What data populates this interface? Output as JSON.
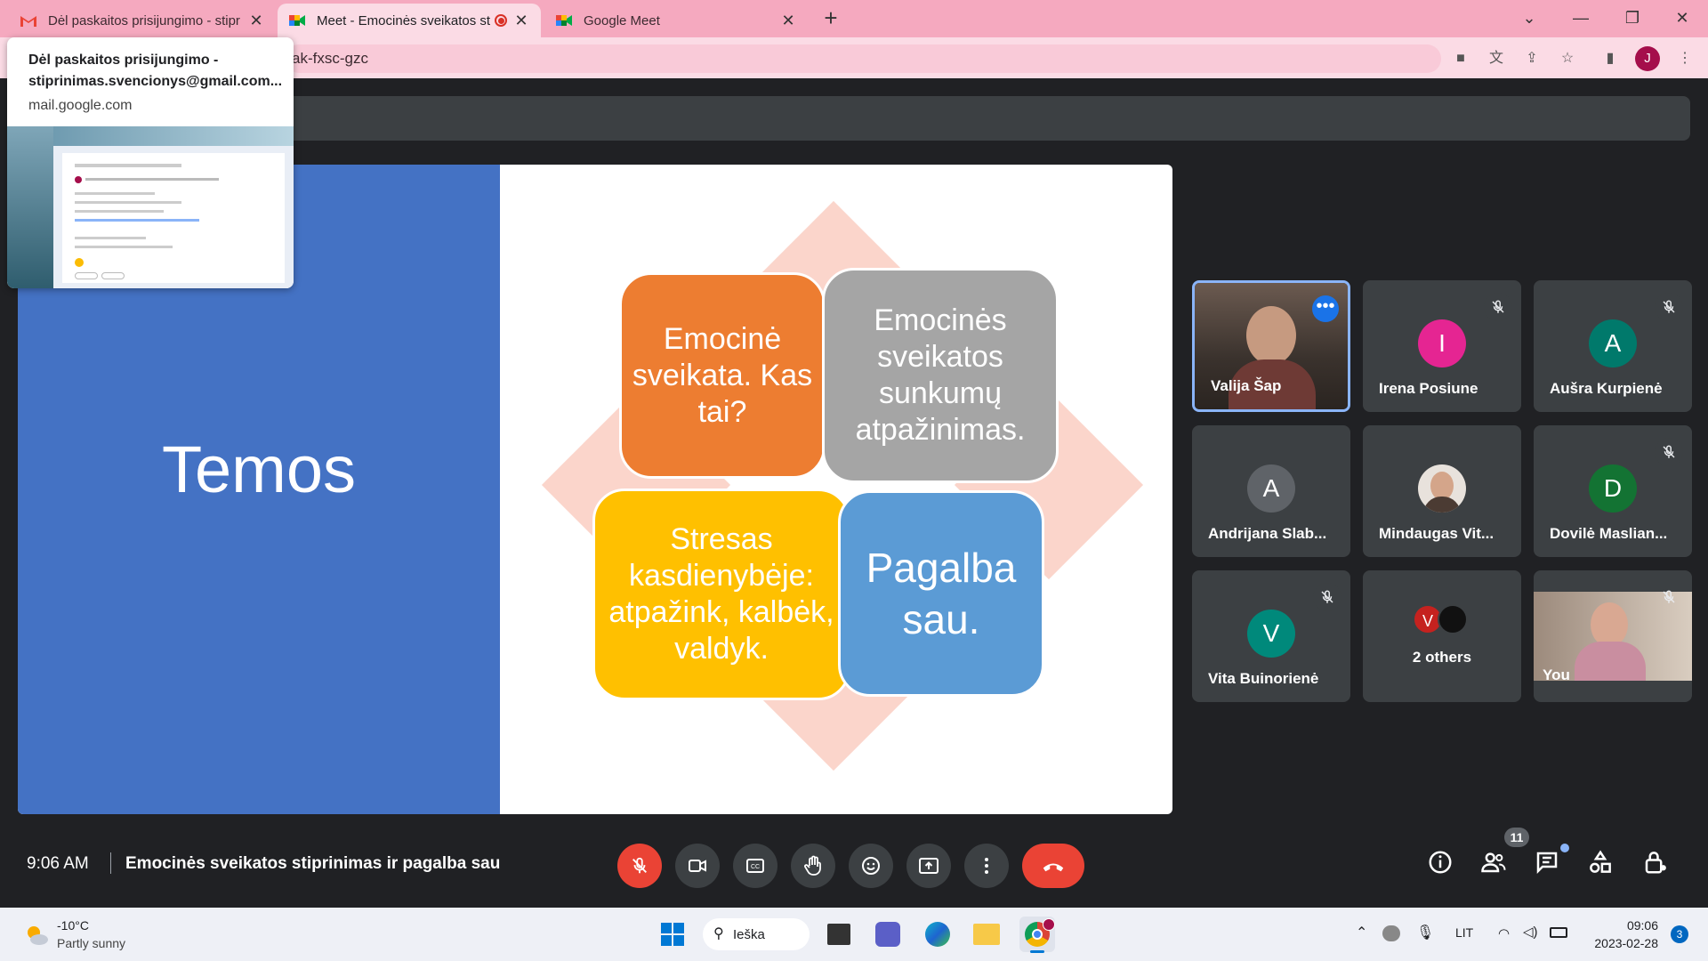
{
  "browser": {
    "tabs": [
      {
        "title": "Dėl paskaitos prisijungimo - stipr",
        "icon": "gmail-icon"
      },
      {
        "title": "Meet - Emocinės sveikatos st",
        "icon": "meet-icon",
        "recording": true
      },
      {
        "title": "Google Meet",
        "icon": "meet-icon"
      }
    ],
    "url_visible": "ak-fxsc-gzc",
    "profile_initial": "J"
  },
  "tab_preview": {
    "title": "Dėl paskaitos prisijungimo - stiprinimas.svencionys@gmail.com...",
    "domain": "mail.google.com"
  },
  "slide": {
    "title": "Temos",
    "boxes": [
      {
        "text": "Emocinė sveikata. Kas tai?",
        "color": "#ed7d31"
      },
      {
        "text": "Emocinės sveikatos sunkumų atpažinimas.",
        "color": "#a5a5a5"
      },
      {
        "text": "Stresas kasdienybėje: atpažink, kalbėk, valdyk.",
        "color": "#ffc000"
      },
      {
        "text": "Pagalba sau.",
        "color": "#5b9bd5"
      }
    ]
  },
  "participants": [
    {
      "name": "Valija Šap",
      "type": "video",
      "speaking": true
    },
    {
      "name": "Irena Posiune",
      "initial": "I",
      "avatar_color": "#e52592",
      "muted": true
    },
    {
      "name": "Aušra Kurpienė",
      "initial": "A",
      "avatar_color": "#00796b",
      "muted": true
    },
    {
      "name": "Andrijana Slab...",
      "initial": "A",
      "avatar_color": "#5f6368",
      "muted": false
    },
    {
      "name": "Mindaugas Vit...",
      "type": "photo",
      "muted": false
    },
    {
      "name": "Dovilė Maslian...",
      "initial": "D",
      "avatar_color": "#137333",
      "muted": true
    },
    {
      "name": "Vita Buinorienė",
      "initial": "V",
      "avatar_color": "#00897b",
      "muted": true
    },
    {
      "name": "2 others",
      "type": "others",
      "initial": "V"
    },
    {
      "name": "You",
      "type": "video",
      "muted": true
    }
  ],
  "meeting": {
    "time": "9:06 AM",
    "title": "Emocinės sveikatos stiprinimas ir pagalba sau",
    "people_count": "11"
  },
  "taskbar": {
    "temperature": "-10°C",
    "weather": "Partly sunny",
    "search_label": "Ieška",
    "language": "LIT",
    "clock_time": "09:06",
    "clock_date": "2023-02-28",
    "notification_count": "3"
  }
}
